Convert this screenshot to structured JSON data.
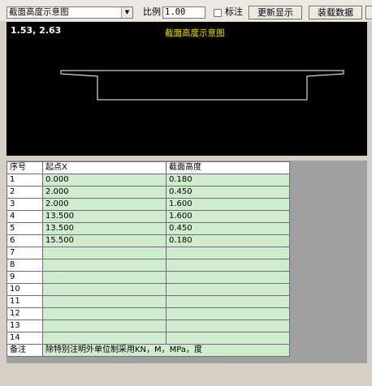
{
  "toolbar": {
    "view_select": "截面高度示意图",
    "scale_label": "比例",
    "scale_value": "1.00",
    "annotate_label": "标注",
    "refresh_button": "更新显示",
    "load_button": "装载数据"
  },
  "canvas": {
    "coord_readout": "1.53, 2.63",
    "title": "截面高度示意图",
    "title_color": "#f0e000"
  },
  "table": {
    "headers": [
      "序号",
      "起点X",
      "截面高度"
    ],
    "rows": [
      [
        "1",
        "0.000",
        "0.180"
      ],
      [
        "2",
        "2.000",
        "0.450"
      ],
      [
        "3",
        "2.000",
        "1.600"
      ],
      [
        "4",
        "13.500",
        "1.600"
      ],
      [
        "5",
        "13.500",
        "0.450"
      ],
      [
        "6",
        "15.500",
        "0.180"
      ],
      [
        "7",
        "",
        ""
      ],
      [
        "8",
        "",
        ""
      ],
      [
        "9",
        "",
        ""
      ],
      [
        "10",
        "",
        ""
      ],
      [
        "11",
        "",
        ""
      ],
      [
        "12",
        "",
        ""
      ],
      [
        "13",
        "",
        ""
      ],
      [
        "14",
        "",
        ""
      ]
    ],
    "note_label": "备注",
    "note_text": "除特别注明外单位制采用KN，M，MPa，度",
    "cell_color": "#cfeccf"
  }
}
